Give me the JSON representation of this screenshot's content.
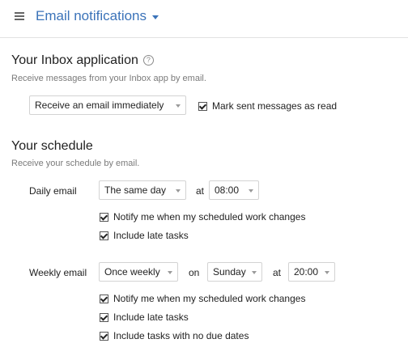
{
  "header": {
    "menu_icon": "hamburger-menu-icon",
    "title": "Email notifications",
    "title_color": "#3b73b9"
  },
  "inbox": {
    "title": "Your Inbox application",
    "help_icon": "help-circle-icon",
    "help_glyph": "?",
    "subtitle": "Receive messages from your Inbox app by email.",
    "frequency_value": "Receive an email immediately",
    "mark_sent": {
      "label": "Mark sent messages as read",
      "checked": true
    }
  },
  "schedule": {
    "title": "Your schedule",
    "subtitle": "Receive your schedule by email.",
    "daily": {
      "label": "Daily email",
      "day_value": "The same day",
      "at_label": "at",
      "time_value": "08:00",
      "options": [
        {
          "label": "Notify me when my scheduled work changes",
          "checked": true
        },
        {
          "label": "Include late tasks",
          "checked": true
        }
      ]
    },
    "weekly": {
      "label": "Weekly email",
      "frequency_value": "Once weekly",
      "on_label": "on",
      "day_value": "Sunday",
      "at_label": "at",
      "time_value": "20:00",
      "options": [
        {
          "label": "Notify me when my scheduled work changes",
          "checked": true
        },
        {
          "label": "Include late tasks",
          "checked": true
        },
        {
          "label": "Include tasks with no due dates",
          "checked": true
        }
      ]
    }
  }
}
